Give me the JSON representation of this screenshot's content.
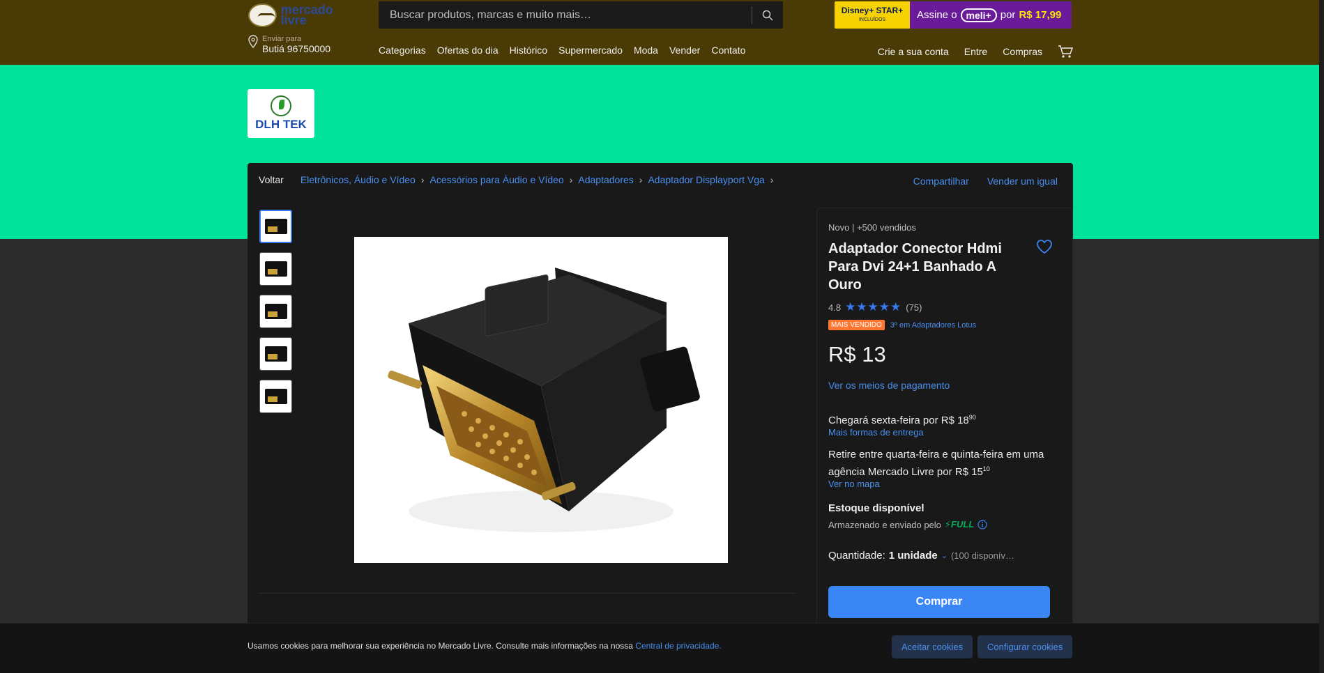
{
  "header": {
    "logo_text": "mercado livre",
    "search_placeholder": "Buscar produtos, marcas e muito mais…",
    "promo": {
      "left_title": "Disney+ STAR+",
      "left_sub": "INCLUÍDOS",
      "text": "Assine o",
      "badge": "meli+",
      "por": "por",
      "price": "R$ 17,99"
    },
    "location_label": "Enviar para",
    "location_value": "Butiá 96750000",
    "nav": [
      "Categorias",
      "Ofertas do dia",
      "Histórico",
      "Supermercado",
      "Moda",
      "Vender",
      "Contato"
    ],
    "nav_right": [
      "Crie a sua conta",
      "Entre",
      "Compras"
    ]
  },
  "store": {
    "name": "DLH TEK"
  },
  "breadcrumb": {
    "back": "Voltar",
    "items": [
      "Eletrônicos, Áudio e Vídeo",
      "Acessórios para Áudio e Vídeo",
      "Adaptadores",
      "Adaptador Displayport Vga"
    ],
    "share": "Compartilhar",
    "sell": "Vender um igual"
  },
  "product": {
    "condition": "Novo  |  +500 vendidos",
    "title": "Adaptador Conector Hdmi Para Dvi 24+1 Banhado A Ouro",
    "rating": "4.8",
    "stars": "★★★★★",
    "reviews": "(75)",
    "best_seller": "MAIS VENDIDO",
    "rank": "3º em Adaptadores Lotus",
    "price": "R$ 13",
    "payment_link": "Ver os meios de pagamento",
    "delivery_text": "Chegará sexta-feira por R$ 18",
    "delivery_cents": "90",
    "delivery_link": "Mais formas de entrega",
    "pickup_text": "Retire entre quarta-feira e quinta-feira em uma agência Mercado Livre por R$ 15",
    "pickup_cents": "10",
    "map_link": "Ver no mapa",
    "stock": "Estoque disponível",
    "stored_text": "Armazenado e enviado pelo",
    "full": "FULL",
    "qty_label": "Quantidade:",
    "qty_value": "1 unidade",
    "qty_available": "(100 disponív…",
    "buy_button": "Comprar"
  },
  "cookie": {
    "message": "Usamos cookies para melhorar sua experiência no Mercado Livre. Consulte mais informações na nossa",
    "link": "Central de privacidade.",
    "accept": "Aceitar cookies",
    "configure": "Configurar cookies"
  },
  "colors": {
    "header": "#4a3a06",
    "band": "#00e19a",
    "accent": "#3a86f5",
    "best_seller": "#ff7733"
  }
}
